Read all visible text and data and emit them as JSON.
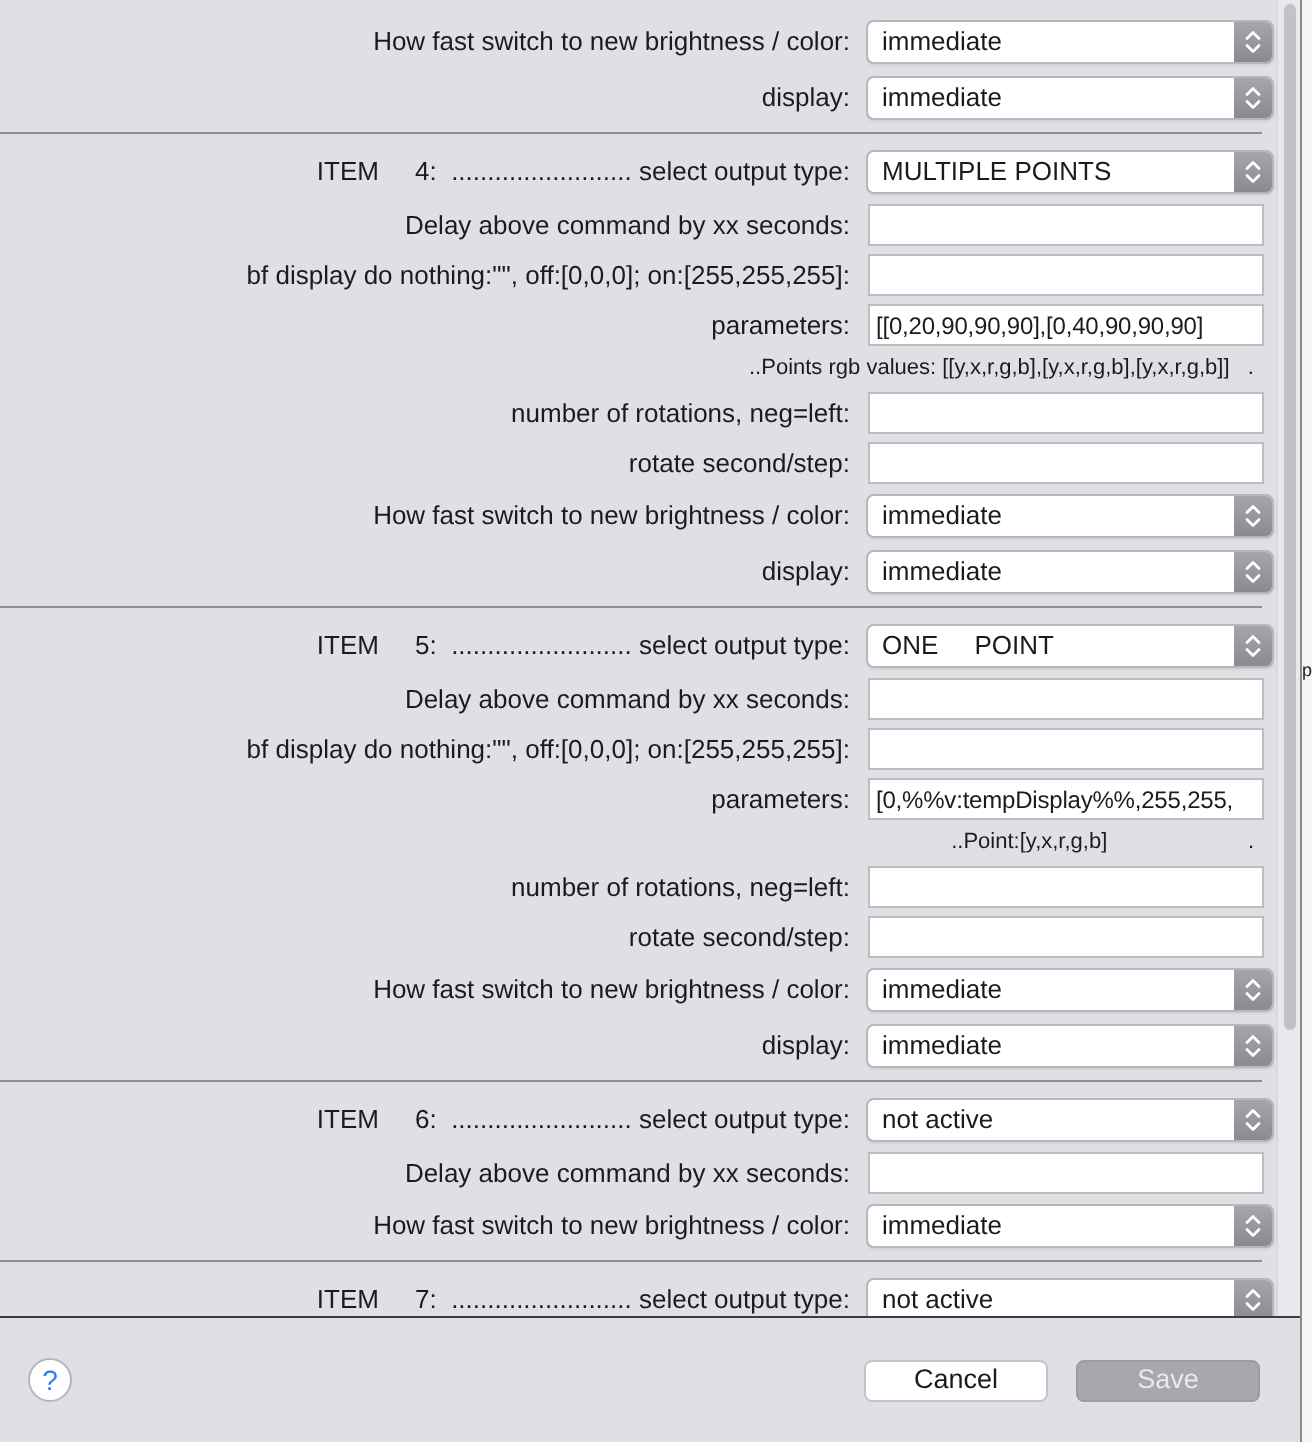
{
  "sections": [
    {
      "rows": [
        {
          "kind": "select",
          "label": "How fast switch to new brightness / color:",
          "value": "immediate"
        },
        {
          "kind": "select",
          "label": "display:",
          "value": "immediate"
        }
      ]
    },
    {
      "rows": [
        {
          "kind": "select",
          "label": "ITEM     4:  ......................... select output type:",
          "value": "MULTIPLE POINTS"
        },
        {
          "kind": "input",
          "label": "Delay above command by xx seconds:"
        },
        {
          "kind": "input",
          "label": "bf display do nothing:\"\", off:[0,0,0]; on:[255,255,255]:"
        },
        {
          "kind": "input",
          "label": "parameters:",
          "value": "[[0,20,90,90,90],[0,40,90,90,90]"
        },
        {
          "kind": "hint",
          "text": "..Points rgb values: [[y,x,r,g,b],[y,x,r,g,b],[y,x,r,g,b]]   ."
        },
        {
          "kind": "input",
          "label": "number of rotations, neg=left:"
        },
        {
          "kind": "input",
          "label": "rotate second/step:"
        },
        {
          "kind": "select",
          "label": "How fast switch to new brightness / color:",
          "value": "immediate"
        },
        {
          "kind": "select",
          "label": "display:",
          "value": "immediate"
        }
      ]
    },
    {
      "rows": [
        {
          "kind": "select",
          "label": "ITEM     5:  ......................... select output type:",
          "value": "ONE     POINT"
        },
        {
          "kind": "input",
          "label": "Delay above command by xx seconds:"
        },
        {
          "kind": "input",
          "label": "bf display do nothing:\"\", off:[0,0,0]; on:[255,255,255]:"
        },
        {
          "kind": "input",
          "label": "parameters:",
          "value": "[0,%%v:tempDisplay%%,255,255,"
        },
        {
          "kind": "hint",
          "text": "..Point:[y,x,r,g,b]                       ."
        },
        {
          "kind": "input",
          "label": "number of rotations, neg=left:"
        },
        {
          "kind": "input",
          "label": "rotate second/step:"
        },
        {
          "kind": "select",
          "label": "How fast switch to new brightness / color:",
          "value": "immediate"
        },
        {
          "kind": "select",
          "label": "display:",
          "value": "immediate"
        }
      ]
    },
    {
      "rows": [
        {
          "kind": "select",
          "label": "ITEM     6:  ......................... select output type:",
          "value": "not active"
        },
        {
          "kind": "input",
          "label": "Delay above command by xx seconds:"
        },
        {
          "kind": "select",
          "label": "How fast switch to new brightness / color:",
          "value": "immediate"
        }
      ]
    },
    {
      "rows": [
        {
          "kind": "select",
          "label": "ITEM     7:  ......................... select output type:",
          "value": "not active"
        }
      ]
    }
  ],
  "footer": {
    "help": "?",
    "buttons": [
      {
        "label": "Cancel",
        "disabled": false
      },
      {
        "label": "Save",
        "disabled": true
      }
    ]
  },
  "background_window": {
    "text": "p"
  }
}
